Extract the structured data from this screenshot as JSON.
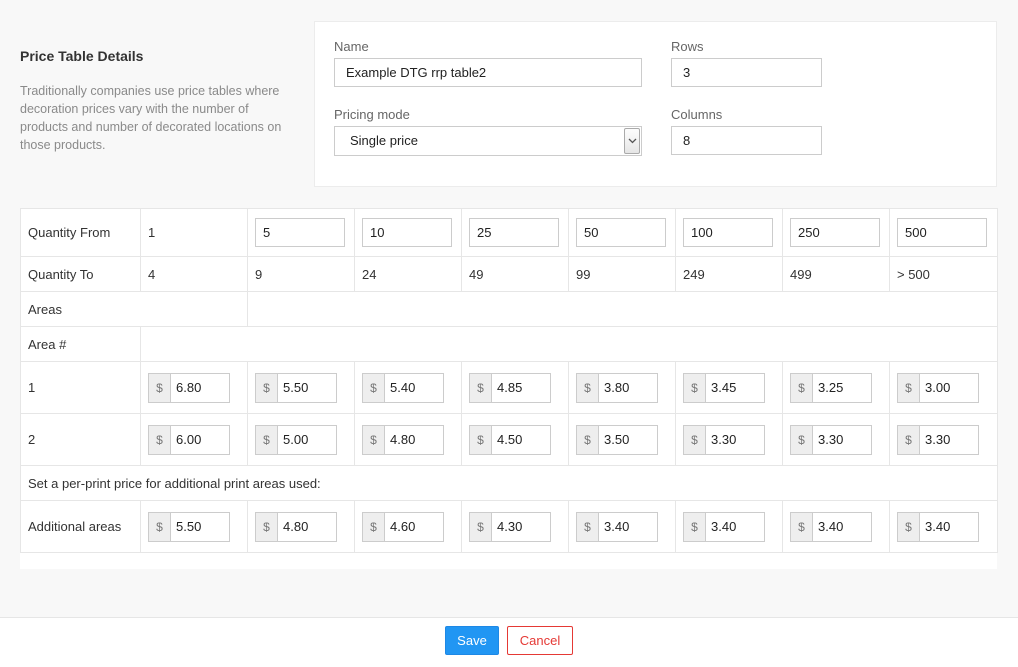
{
  "section": {
    "title": "Price Table Details",
    "description": "Traditionally companies use price tables where decoration prices vary with the number of products and number of decorated locations on those products."
  },
  "form": {
    "name_label": "Name",
    "name_value": "Example  DTG rrp table2",
    "rows_label": "Rows",
    "rows_value": "3",
    "pricing_mode_label": "Pricing mode",
    "pricing_mode_value": "Single price",
    "columns_label": "Columns",
    "columns_value": "8"
  },
  "table": {
    "currency_symbol": "$",
    "quantity_from_label": "Quantity From",
    "quantity_from": [
      "1",
      "5",
      "10",
      "25",
      "50",
      "100",
      "250",
      "500"
    ],
    "quantity_to_label": "Quantity To",
    "quantity_to": [
      "4",
      "9",
      "24",
      "49",
      "99",
      "249",
      "499",
      "> 500"
    ],
    "areas_label": "Areas",
    "area_num_label": "Area #",
    "area_rows": [
      {
        "label": "1",
        "prices": [
          "6.80",
          "5.50",
          "5.40",
          "4.85",
          "3.80",
          "3.45",
          "3.25",
          "3.00"
        ]
      },
      {
        "label": "2",
        "prices": [
          "6.00",
          "5.00",
          "4.80",
          "4.50",
          "3.50",
          "3.30",
          "3.30",
          "3.30"
        ]
      }
    ],
    "additional_note": "Set a per-print price for additional print areas used:",
    "additional_label": "Additional areas",
    "additional_prices": [
      "5.50",
      "4.80",
      "4.60",
      "4.30",
      "3.40",
      "3.40",
      "3.40",
      "3.40"
    ]
  },
  "footer": {
    "save_label": "Save",
    "cancel_label": "Cancel"
  },
  "colors": {
    "primary": "#2196f3",
    "danger": "#e53935",
    "background": "#f8f8f8"
  },
  "icons": {
    "select_arrow": "chevron-down-icon"
  }
}
